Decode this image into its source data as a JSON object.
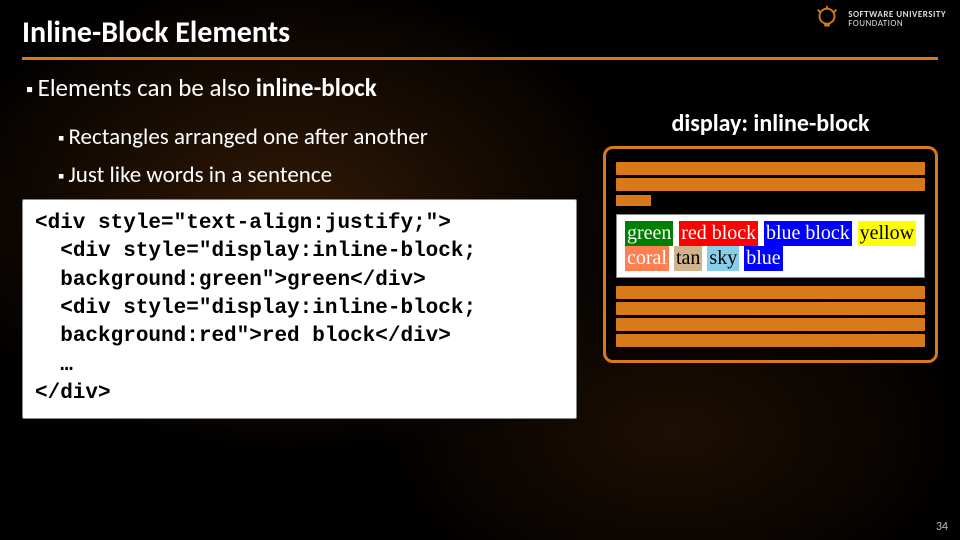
{
  "logo": {
    "line1": "SOFTWARE UNIVERSITY",
    "line2": "FOUNDATION"
  },
  "title": "Inline-Block Elements",
  "bullets": {
    "b1_prefix": "Elements can be also ",
    "b1_kw": "inline-block",
    "b2": "Rectangles arranged one after another",
    "b3": "Just like words in a sentence"
  },
  "code": "<div style=\"text-align:justify;\">\n  <div style=\"display:inline-block;\n  background:green\">green</div>\n  <div style=\"display:inline-block;\n  background:red\">red block</div>\n  …\n</div>",
  "right_title": "display: inline-block",
  "demo_words": {
    "green": "green",
    "red": "red block",
    "blueblock": "blue block",
    "yellow": "yellow",
    "coral": "coral",
    "tan": "tan",
    "sky": "sky",
    "blue": "blue"
  },
  "slide_number": "34"
}
